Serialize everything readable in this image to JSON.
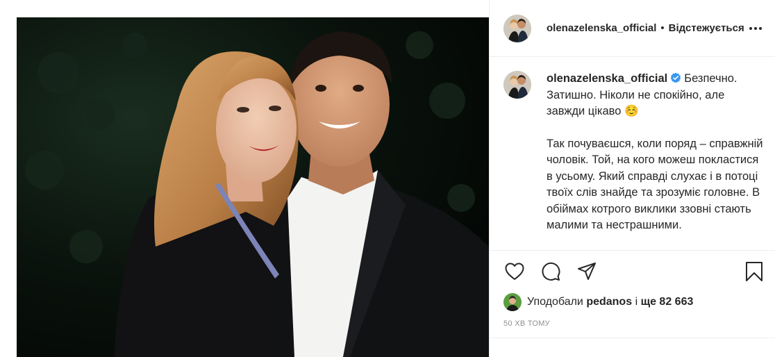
{
  "header": {
    "username": "olenazelenska_official",
    "separator": "•",
    "follow_status": "Відстежується",
    "more_icon": "more-horizontal-icon"
  },
  "caption": {
    "username": "olenazelenska_official",
    "verified_icon": "verified-badge-icon",
    "paragraph1": "Безпечно. Затишно. Ніколи не спокійно, але завжди цікаво ☺️",
    "paragraph2": "Так почуваєшся, коли поряд – справжній чоловік. Той, на кого можеш покластися в усьому. Який справді слухає і в потоці твоїх слів знайде та зрозуміє головне. В обіймах котрого виклики ззовні стають малими та нестрашними."
  },
  "actions": {
    "like_icon": "heart-icon",
    "comment_icon": "comment-icon",
    "share_icon": "paper-plane-icon",
    "save_icon": "bookmark-icon"
  },
  "likes": {
    "prefix": "Уподобали",
    "user": "pedanos",
    "conjunction": "і",
    "count_text": "ще 82 663"
  },
  "timestamp": "50 ХВ ТОМУ",
  "colors": {
    "text": "#262626",
    "muted": "#8e8e8e",
    "border": "#efefef",
    "verified": "#3897f0"
  }
}
